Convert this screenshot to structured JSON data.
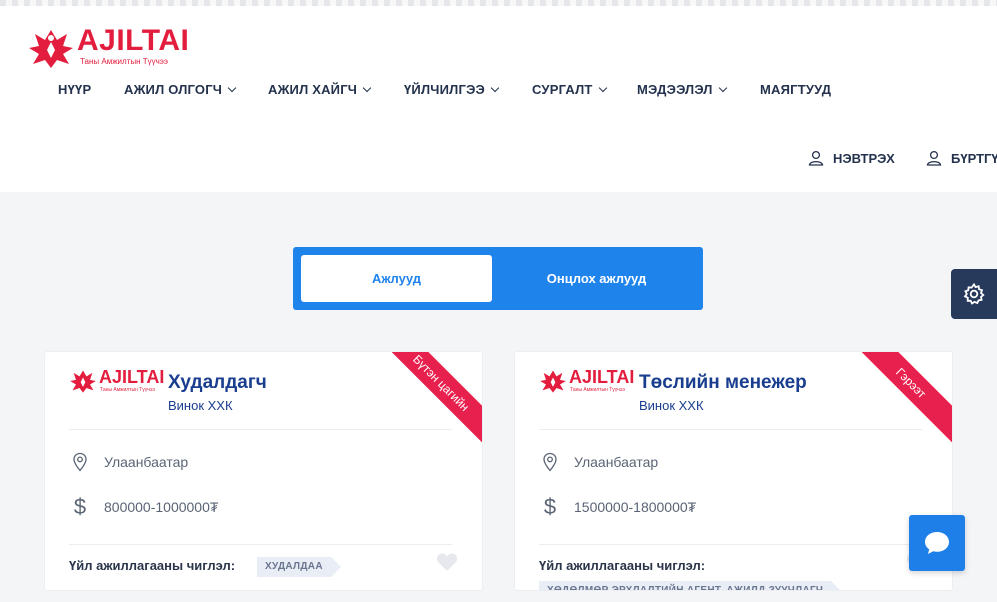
{
  "brand": {
    "name": "AJILTAI",
    "tagline": "Таны Амжилтын Түүчээ",
    "color": "#e31d3d"
  },
  "nav": {
    "items": [
      {
        "label": "НҮҮР",
        "has_dropdown": false
      },
      {
        "label": "АЖИЛ ОЛГОГЧ",
        "has_dropdown": true
      },
      {
        "label": "АЖИЛ ХАЙГЧ",
        "has_dropdown": true
      },
      {
        "label": "ҮЙЛЧИЛГЭЭ",
        "has_dropdown": true
      },
      {
        "label": "СУРГАЛТ",
        "has_dropdown": true
      },
      {
        "label": "МЭДЭЭЛЭЛ",
        "has_dropdown": true
      },
      {
        "label": "МАЯГТУУД",
        "has_dropdown": false
      }
    ]
  },
  "auth": {
    "login_label": "НЭВТРЭХ",
    "register_label": "БҮРТГҮ"
  },
  "toggle": {
    "active_tab": "Ажлууд",
    "other_tab": "Онцлох ажлууд",
    "accent": "#1f83ec"
  },
  "jobs": [
    {
      "title": "Худалдагч",
      "company": "Винок ХХК",
      "ribbon": "Бүтэн цагийн",
      "location": "Улаанбаатар",
      "salary": "800000-1000000₮",
      "field_label": "Үйл ажиллагааны чиглэл:",
      "field_tag": "ХУДАЛДАА"
    },
    {
      "title": "Төслийн менежер",
      "company": "Винок ХХК",
      "ribbon": "Гэрээт",
      "location": "Улаанбаатар",
      "salary": "1500000-1800000₮",
      "field_label": "Үйл ажиллагааны чиглэл:",
      "field_tag": "ХӨДӨЛМӨР ЭРХЛАЛТИЙН АГЕНТ, АЖИЛД ЗУУЧЛАГЧ"
    }
  ],
  "icons": {
    "settings": "gear-icon",
    "chat": "chat-bubble-icon",
    "location": "map-pin-icon",
    "salary": "dollar-icon",
    "favorite": "heart-icon",
    "user": "user-icon"
  },
  "colors": {
    "nav_text": "#24324e",
    "title_text": "#1a3e8f",
    "ribbon": "#e8204d",
    "settings_bg": "#273a5c",
    "chat_bg": "#1f7fe8"
  }
}
